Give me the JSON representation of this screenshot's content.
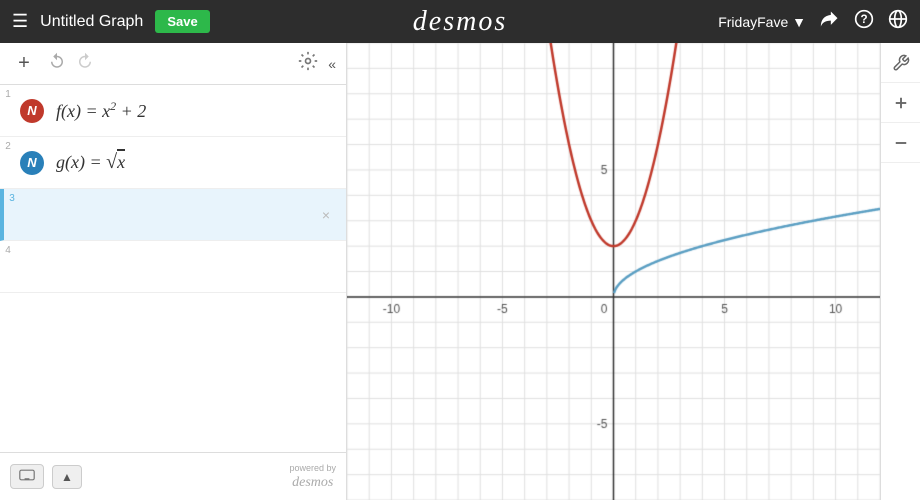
{
  "header": {
    "menu_icon": "☰",
    "title": "Untitled Graph",
    "save_label": "Save",
    "desmos_logo": "desmos",
    "username": "FridayFave",
    "share_icon": "⬆",
    "help_icon": "?",
    "globe_icon": "🌐"
  },
  "toolbar": {
    "add_label": "+",
    "undo_icon": "↩",
    "redo_icon": "↪",
    "settings_icon": "⚙",
    "collapse_icon": "«"
  },
  "expressions": [
    {
      "row_num": "1",
      "color": "red",
      "expr_html": "f(x) = x² + 2",
      "close": "×"
    },
    {
      "row_num": "2",
      "color": "blue",
      "expr_html": "g(x) = √x",
      "close": "×"
    },
    {
      "row_num": "3",
      "color": "teal",
      "expr_html": "",
      "close": "×"
    },
    {
      "row_num": "4",
      "color": "",
      "expr_html": "",
      "close": ""
    }
  ],
  "footer": {
    "keyboard_icon": "⌨",
    "expand_icon": "▲",
    "powered_by": "powered by",
    "desmos_small": "desmos"
  },
  "graph": {
    "x_labels": [
      "-10",
      "-5",
      "0",
      "5",
      "10"
    ],
    "y_labels": [
      "5",
      "-5"
    ],
    "accent_color": "#2d2d2d"
  },
  "right_toolbar": {
    "wrench_icon": "🔧",
    "plus_icon": "+",
    "minus_icon": "−"
  }
}
